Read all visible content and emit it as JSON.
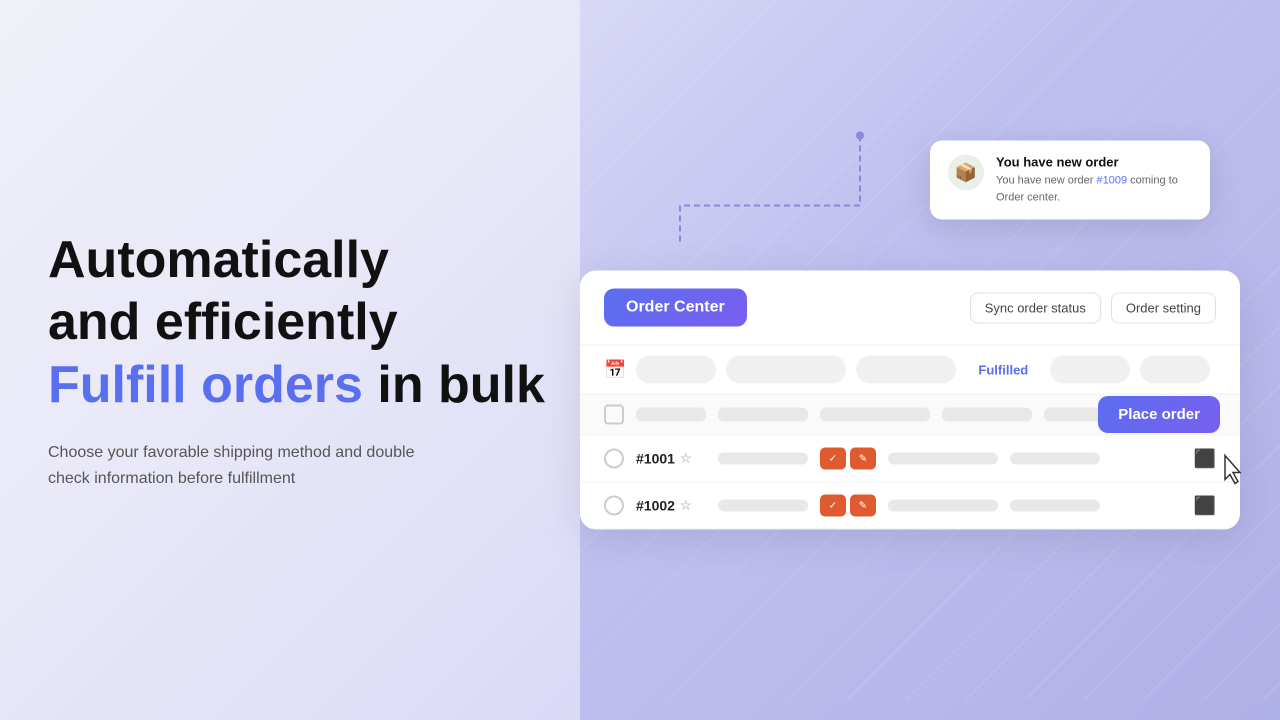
{
  "background": {
    "left_color": "#f0f0f8",
    "right_color": "#c8c8f0"
  },
  "left": {
    "line1": "Automatically",
    "line2": "and efficiently",
    "line3_highlight": "Fulfill orders",
    "line3_rest": " in bulk",
    "subtext_line1": "Choose your favorable shipping method and double",
    "subtext_line2": "check information before fulfillment"
  },
  "notification": {
    "icon": "📦",
    "title": "You have new order",
    "body_prefix": "You have new order ",
    "body_link": "#1009",
    "body_suffix": " coming to Order center."
  },
  "panel": {
    "order_center_label": "Order Center",
    "sync_btn": "Sync order status",
    "setting_btn": "Order setting",
    "filter_active": "Fulfilled",
    "place_order_btn": "Place order",
    "rows": [
      {
        "id": "#1001",
        "has_star": true,
        "badges": [
          "✓",
          "✎"
        ]
      },
      {
        "id": "#1002",
        "has_star": true,
        "badges": [
          "✓",
          "✎"
        ]
      }
    ]
  },
  "colors": {
    "accent": "#5a6ef0",
    "badge_orange": "#e05a30",
    "text_dark": "#111111",
    "text_mid": "#555555"
  }
}
